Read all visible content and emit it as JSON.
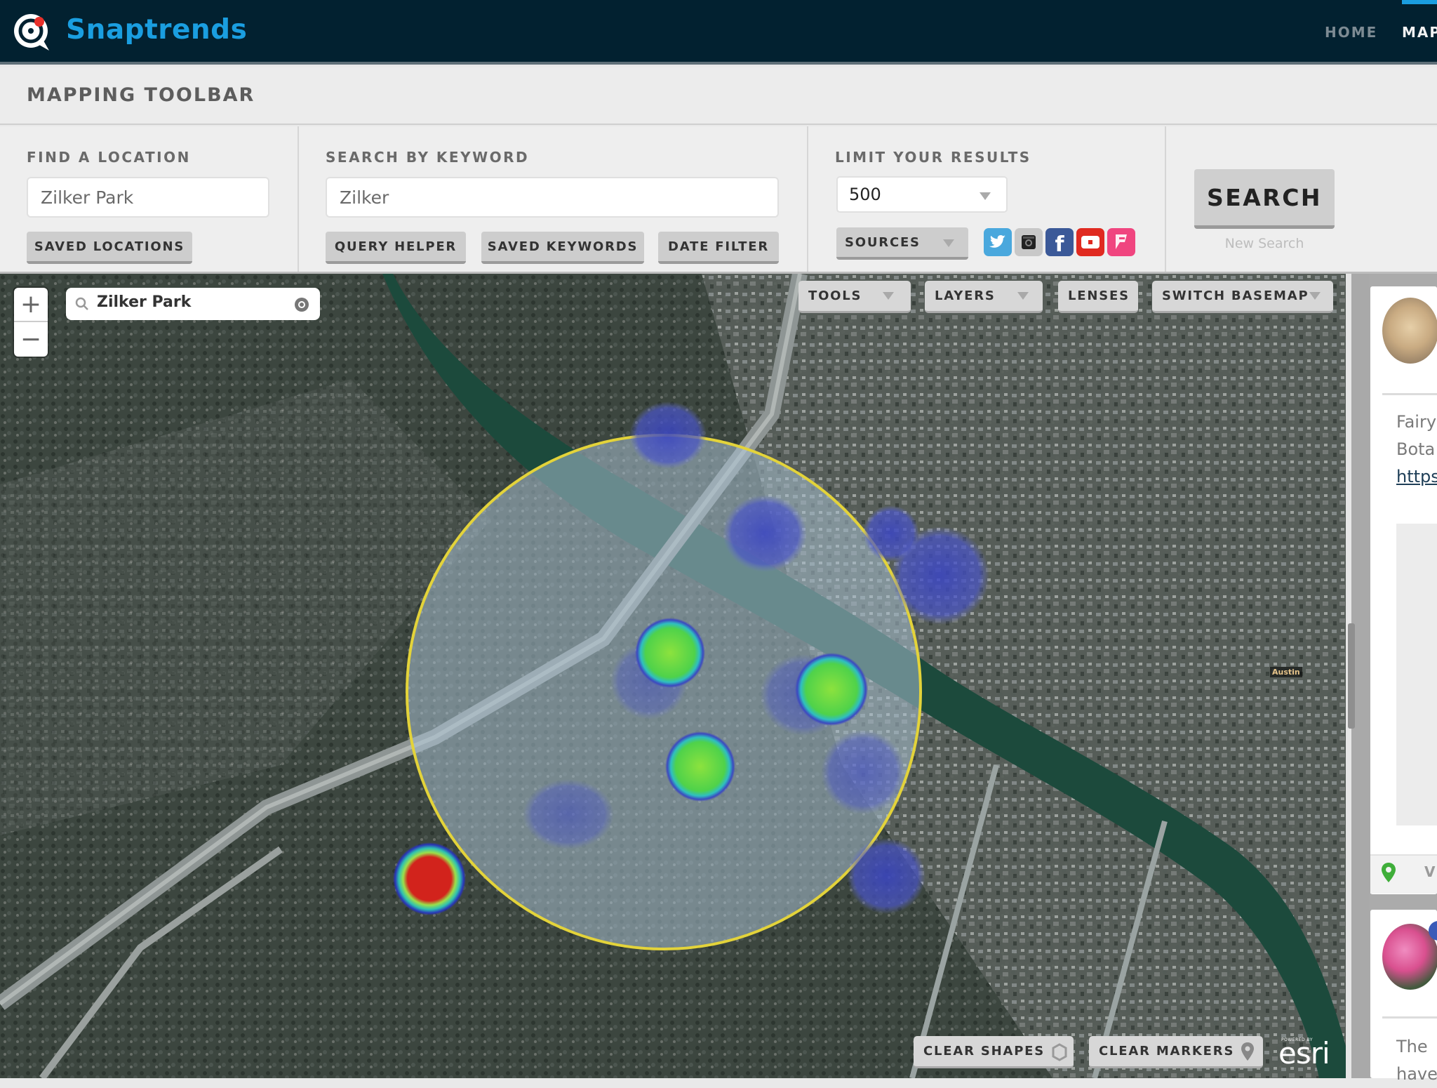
{
  "app": {
    "brand": "Snaptrends",
    "brand_color": "#1a9ee0",
    "nav": [
      {
        "label": "HOME",
        "active": false
      },
      {
        "label": "MAP",
        "active": true
      }
    ]
  },
  "toolbar": {
    "title": "MAPPING TOOLBAR",
    "find_location": {
      "label": "FIND A LOCATION",
      "value": "Zilker Park",
      "saved_button": "SAVED LOCATIONS"
    },
    "keyword": {
      "label": "SEARCH BY KEYWORD",
      "value": "Zilker",
      "buttons": [
        "QUERY HELPER",
        "SAVED KEYWORDS",
        "DATE FILTER"
      ]
    },
    "limit": {
      "label": "LIMIT YOUR RESULTS",
      "selected": "500",
      "sources_label": "SOURCES",
      "sources": [
        {
          "name": "twitter",
          "glyph": "t",
          "color": "#4aa8dd"
        },
        {
          "name": "instagram",
          "glyph": "◙",
          "color": "#c8c8c8"
        },
        {
          "name": "facebook",
          "glyph": "f",
          "color": "#3b5998"
        },
        {
          "name": "youtube",
          "glyph": "▶",
          "color": "#e02a20"
        },
        {
          "name": "foursquare",
          "glyph": "F",
          "color": "#f0457f"
        }
      ]
    },
    "search_button": "SEARCH",
    "new_search": "New Search"
  },
  "map": {
    "search_value": "Zilker Park",
    "zoom_in": "+",
    "zoom_out": "−",
    "controls": [
      {
        "label": "TOOLS",
        "dropdown": true
      },
      {
        "label": "LAYERS",
        "dropdown": true
      },
      {
        "label": "LENSES",
        "dropdown": false
      },
      {
        "label": "SWITCH BASEMAP",
        "dropdown": true
      }
    ],
    "bottom_buttons": [
      {
        "label": "CLEAR SHAPES",
        "icon": "shape-icon"
      },
      {
        "label": "CLEAR MARKERS",
        "icon": "marker-icon"
      }
    ],
    "attribution": "esri",
    "attribution_small": "POWERED BY",
    "labels": [
      {
        "text": "Austin",
        "color": "#e6c48a"
      }
    ],
    "overlay_colors": {
      "radius_circle": "#e3d33a",
      "hotspot_high": "#d2231c",
      "hotspot_mid": "#5fdc3c",
      "hotspot_low": "#4652c8"
    }
  },
  "feed": {
    "posts": [
      {
        "text_lines": [
          "Fairy",
          "Bota"
        ],
        "link": "https:",
        "footer_label": "VI"
      },
      {
        "text_lines": [
          "The",
          "have"
        ]
      }
    ]
  }
}
